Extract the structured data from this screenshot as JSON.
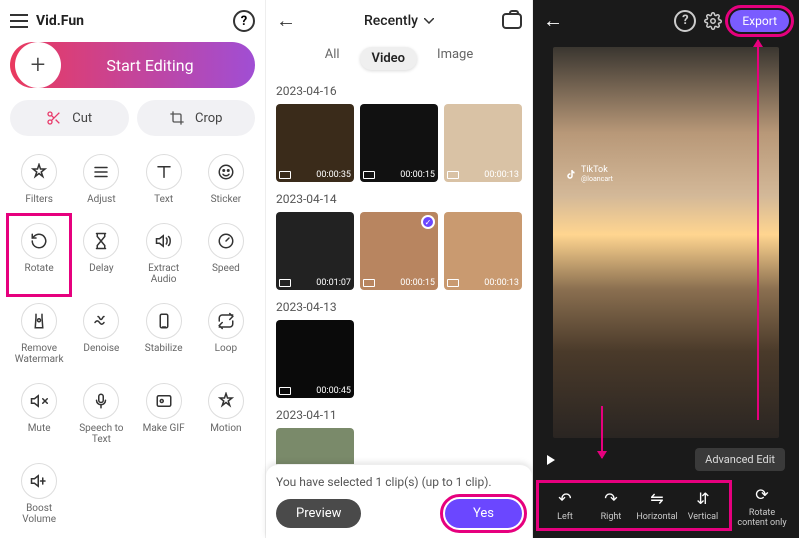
{
  "app": {
    "name": "Vid.Fun",
    "start_label": "Start Editing"
  },
  "cutcrop": {
    "cut": "Cut",
    "crop": "Crop"
  },
  "tools": [
    {
      "id": "filters",
      "label": "Filters"
    },
    {
      "id": "adjust",
      "label": "Adjust"
    },
    {
      "id": "text",
      "label": "Text"
    },
    {
      "id": "sticker",
      "label": "Sticker"
    },
    {
      "id": "rotate",
      "label": "Rotate"
    },
    {
      "id": "delay",
      "label": "Delay"
    },
    {
      "id": "extract-audio",
      "label": "Extract\nAudio"
    },
    {
      "id": "speed",
      "label": "Speed"
    },
    {
      "id": "remove-watermark",
      "label": "Remove\nWatermark"
    },
    {
      "id": "denoise",
      "label": "Denoise"
    },
    {
      "id": "stabilize",
      "label": "Stabilize"
    },
    {
      "id": "loop",
      "label": "Loop"
    },
    {
      "id": "mute",
      "label": "Mute"
    },
    {
      "id": "speech-to-text",
      "label": "Speech to\nText"
    },
    {
      "id": "make-gif",
      "label": "Make GIF"
    },
    {
      "id": "motion",
      "label": "Motion"
    },
    {
      "id": "boost-volume",
      "label": "Boost\nVolume"
    }
  ],
  "gallery": {
    "sort": "Recently",
    "tabs": {
      "all": "All",
      "video": "Video",
      "image": "Image"
    },
    "groups": [
      {
        "date": "2023-04-16",
        "items": [
          {
            "dur": "00:00:35",
            "bg": "#3a2b1a"
          },
          {
            "dur": "00:00:15",
            "bg": "#111"
          },
          {
            "dur": "00:00:13",
            "bg": "#d9c2a5"
          }
        ]
      },
      {
        "date": "2023-04-14",
        "items": [
          {
            "dur": "00:01:07",
            "bg": "#222"
          },
          {
            "dur": "00:00:15",
            "bg": "#b88560",
            "selected": true
          },
          {
            "dur": "00:00:13",
            "bg": "#c99a70"
          }
        ]
      },
      {
        "date": "2023-04-13",
        "items": [
          {
            "dur": "00:00:45",
            "bg": "#0a0a0a"
          }
        ]
      },
      {
        "date": "2023-04-11",
        "items": [
          {
            "dur": "",
            "bg": "#7a8a6a"
          }
        ]
      }
    ],
    "footer": {
      "msg": "You have selected 1 clip(s) (up to 1 clip).",
      "preview": "Preview",
      "yes": "Yes"
    }
  },
  "editor": {
    "export": "Export",
    "watermark": "TikTok",
    "watermark_user": "@loancart",
    "advanced": "Advanced Edit",
    "rot": {
      "left": "Left",
      "right": "Right",
      "horizontal": "Horizontal",
      "vertical": "Vertical",
      "content_only": "Rotate content only"
    }
  }
}
